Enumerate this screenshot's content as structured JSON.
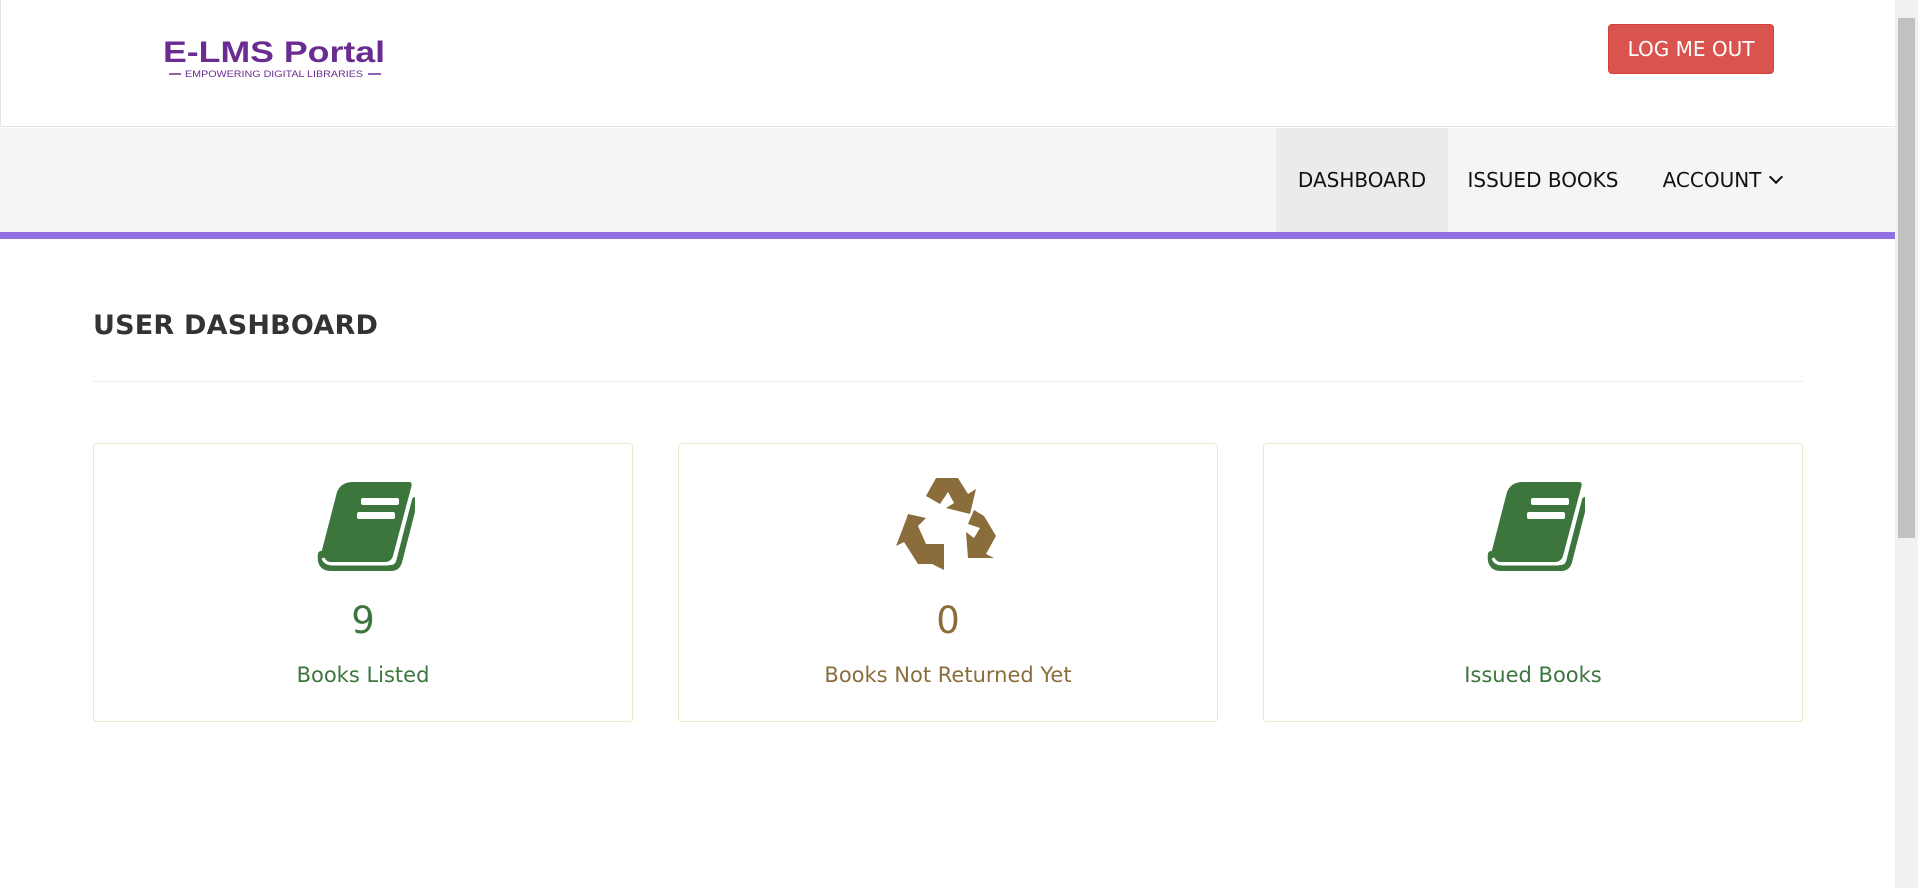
{
  "header": {
    "logo_text": "E-LMS Portal",
    "logo_tagline": "EMPOWERING DIGITAL LIBRARIES",
    "logout_label": "LOG ME OUT"
  },
  "nav": {
    "items": [
      {
        "label": "DASHBOARD",
        "active": true
      },
      {
        "label": "ISSUED BOOKS",
        "active": false
      },
      {
        "label": "ACCOUNT",
        "active": false,
        "dropdown": true
      }
    ]
  },
  "main": {
    "title": "USER DASHBOARD",
    "cards": [
      {
        "count": "9",
        "label": "Books Listed",
        "icon": "book-icon",
        "color": "#3c763d"
      },
      {
        "count": "0",
        "label": "Books Not Returned Yet",
        "icon": "recycle-icon",
        "color": "#8a6d3b"
      },
      {
        "count": "",
        "label": "Issued Books",
        "icon": "book-icon",
        "color": "#3c763d"
      }
    ]
  },
  "colors": {
    "accent": "#9170e4",
    "danger": "#d9534f",
    "success": "#3c763d",
    "warning": "#8a6d3b"
  }
}
